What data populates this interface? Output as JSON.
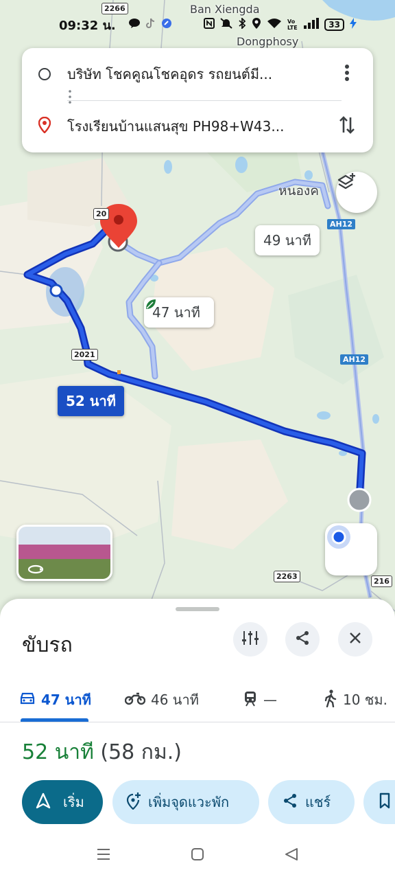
{
  "status_bar": {
    "time": "09:32 น.",
    "battery": "33"
  },
  "map": {
    "labels": {
      "ban_xiengda": "Ban Xiengda",
      "dongphosy": "Dongphosy",
      "nongkhai": "หนองค"
    },
    "road_shields": {
      "r2266": "2266",
      "r2021_top": "20",
      "r2021": "2021",
      "r2263": "2263",
      "r216": "216",
      "ah12_a": "AH12",
      "ah12_b": "AH12"
    },
    "route_labels": {
      "primary": "52 นาที",
      "alt1": "47 นาที",
      "alt2": "49 นาที"
    }
  },
  "route_card": {
    "origin": "บริษัท โชคคูณโชคอุดร รถยนต์มี...",
    "destination": "โรงเรียนบ้านแสนสุข PH98+W43..."
  },
  "sheet": {
    "title": "ขับรถ",
    "tabs": [
      {
        "mode": "car",
        "label": "47 นาที"
      },
      {
        "mode": "motorbike",
        "label": "46 นาที"
      },
      {
        "mode": "transit",
        "label": "—"
      },
      {
        "mode": "walk",
        "label": "10 ชม."
      }
    ],
    "summary": {
      "duration": "52 นาที",
      "distance": "(58 กม.)"
    },
    "actions": {
      "start": "เริ่ม",
      "add_stop": "เพิ่มจุดแวะพัก",
      "share": "แชร์"
    }
  },
  "colors": {
    "primary_route": "#1a4fc4",
    "alt_route": "#9fb8ef",
    "duration_green": "#188038",
    "start_button": "#0b6b8a"
  }
}
